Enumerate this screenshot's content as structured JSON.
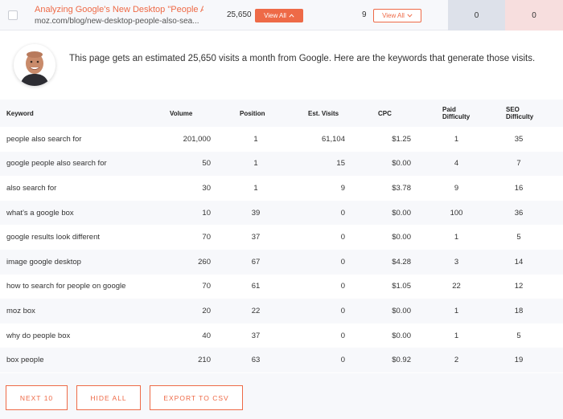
{
  "top_row": {
    "page_title": "Analyzing Google's New Desktop \"People Als...",
    "page_url": "moz.com/blog/new-desktop-people-also-sea...",
    "visits": "25,650",
    "view_all_label": "View All",
    "count": "9",
    "view_all_outline_label": "View All",
    "col_a": "0",
    "col_b": "0"
  },
  "intro": {
    "text": "This page gets an estimated 25,650 visits a month from Google. Here are the keywords that generate those visits."
  },
  "table": {
    "headers": {
      "keyword": "Keyword",
      "volume": "Volume",
      "position": "Position",
      "est_visits": "Est. Visits",
      "cpc": "CPC",
      "paid_difficulty": "Paid Difficulty",
      "seo_difficulty": "SEO Difficulty"
    },
    "rows": [
      {
        "keyword": "people also search for",
        "volume": "201,000",
        "position": "1",
        "visits": "61,104",
        "cpc": "$1.25",
        "paid": "1",
        "seo": "35"
      },
      {
        "keyword": "google people also search for",
        "volume": "50",
        "position": "1",
        "visits": "15",
        "cpc": "$0.00",
        "paid": "4",
        "seo": "7"
      },
      {
        "keyword": "also search for",
        "volume": "30",
        "position": "1",
        "visits": "9",
        "cpc": "$3.78",
        "paid": "9",
        "seo": "16"
      },
      {
        "keyword": "what's a google box",
        "volume": "10",
        "position": "39",
        "visits": "0",
        "cpc": "$0.00",
        "paid": "100",
        "seo": "36"
      },
      {
        "keyword": "google results look different",
        "volume": "70",
        "position": "37",
        "visits": "0",
        "cpc": "$0.00",
        "paid": "1",
        "seo": "5"
      },
      {
        "keyword": "image google desktop",
        "volume": "260",
        "position": "67",
        "visits": "0",
        "cpc": "$4.28",
        "paid": "3",
        "seo": "14"
      },
      {
        "keyword": "how to search for people on google",
        "volume": "70",
        "position": "61",
        "visits": "0",
        "cpc": "$1.05",
        "paid": "22",
        "seo": "12"
      },
      {
        "keyword": "moz box",
        "volume": "20",
        "position": "22",
        "visits": "0",
        "cpc": "$0.00",
        "paid": "1",
        "seo": "18"
      },
      {
        "keyword": "why do people box",
        "volume": "40",
        "position": "37",
        "visits": "0",
        "cpc": "$0.00",
        "paid": "1",
        "seo": "5"
      },
      {
        "keyword": "box people",
        "volume": "210",
        "position": "63",
        "visits": "0",
        "cpc": "$0.92",
        "paid": "2",
        "seo": "19"
      }
    ]
  },
  "actions": {
    "next_label": "NEXT 10",
    "hide_label": "HIDE ALL",
    "export_label": "EXPORT TO CSV"
  },
  "colors": {
    "accent": "#ee6a47",
    "row_alt": "#f7f8fb"
  }
}
